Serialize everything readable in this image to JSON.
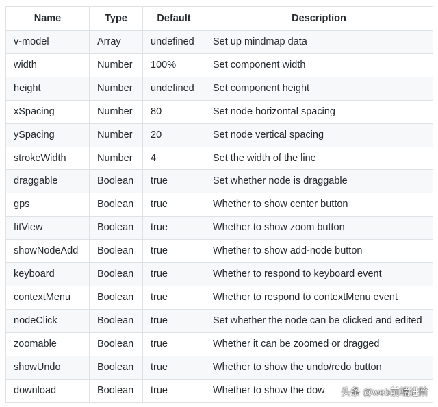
{
  "table": {
    "headers": [
      "Name",
      "Type",
      "Default",
      "Description"
    ],
    "rows": [
      [
        "v-model",
        "Array",
        "undefined",
        "Set up mindmap data"
      ],
      [
        "width",
        "Number",
        "100%",
        "Set component width"
      ],
      [
        "height",
        "Number",
        "undefined",
        "Set component height"
      ],
      [
        "xSpacing",
        "Number",
        "80",
        "Set node horizontal spacing"
      ],
      [
        "ySpacing",
        "Number",
        "20",
        "Set node vertical spacing"
      ],
      [
        "strokeWidth",
        "Number",
        "4",
        "Set the width of the line"
      ],
      [
        "draggable",
        "Boolean",
        "true",
        "Set whether node is draggable"
      ],
      [
        "gps",
        "Boolean",
        "true",
        "Whether to show center button"
      ],
      [
        "fitView",
        "Boolean",
        "true",
        "Whether to show zoom button"
      ],
      [
        "showNodeAdd",
        "Boolean",
        "true",
        "Whether to show add-node button"
      ],
      [
        "keyboard",
        "Boolean",
        "true",
        "Whether to respond to keyboard event"
      ],
      [
        "contextMenu",
        "Boolean",
        "true",
        "Whether to respond to contextMenu event"
      ],
      [
        "nodeClick",
        "Boolean",
        "true",
        "Set whether the node can be clicked and edited"
      ],
      [
        "zoomable",
        "Boolean",
        "true",
        "Whether it can be zoomed or dragged"
      ],
      [
        "showUndo",
        "Boolean",
        "true",
        "Whether to show the undo/redo button"
      ],
      [
        "download",
        "Boolean",
        "true",
        "Whether to show the dow"
      ]
    ]
  },
  "watermark": "头条 @web前端进阶"
}
